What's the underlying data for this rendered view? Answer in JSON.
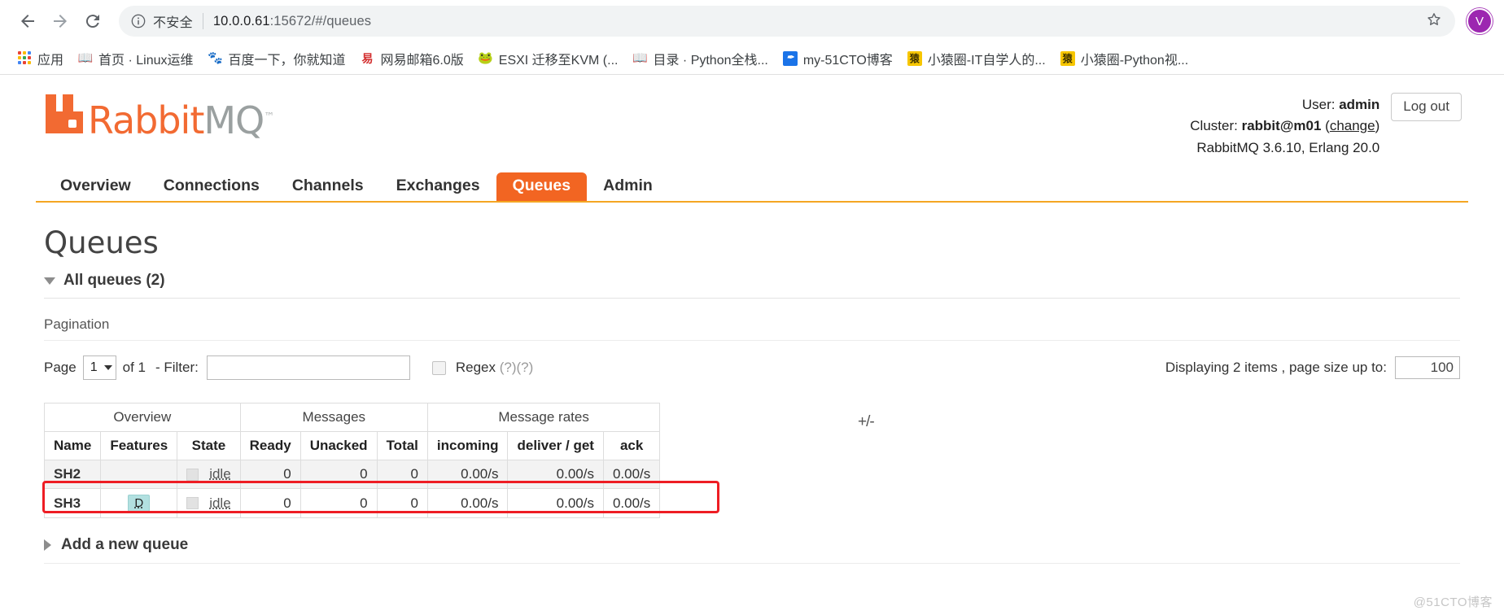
{
  "browser": {
    "back_icon": "back-arrow-icon",
    "forward_icon": "forward-arrow-icon",
    "reload_icon": "reload-icon",
    "security_label": "不安全",
    "url_host": "10.0.0.61",
    "url_rest": ":15672/#/queues",
    "star_icon": "star-icon",
    "profile_initial": "V",
    "bookmarks": [
      {
        "label": "应用",
        "icon": "apps-grid-icon",
        "icon_glyph": "",
        "icon_class": "ico-apps"
      },
      {
        "label": "首页 · Linux运维",
        "icon": "book-icon",
        "icon_glyph": "📖",
        "icon_class": "ico-book"
      },
      {
        "label": "百度一下，你就知道",
        "icon": "baidu-paw-icon",
        "icon_glyph": "🐾",
        "icon_class": "ico-baidu"
      },
      {
        "label": "网易邮箱6.0版",
        "icon": "netease-mail-icon",
        "icon_glyph": "易",
        "icon_class": "ico-163"
      },
      {
        "label": "ESXI 迁移至KVM (...",
        "icon": "esxi-icon",
        "icon_glyph": "🐸",
        "icon_class": "ico-esxi"
      },
      {
        "label": "目录 · Python全栈...",
        "icon": "book-icon",
        "icon_glyph": "📖",
        "icon_class": "ico-book"
      },
      {
        "label": "my-51CTO博客",
        "icon": "feather-icon",
        "icon_glyph": "✒",
        "icon_class": "ico-blue"
      },
      {
        "label": "小猿圈-IT自学人的...",
        "icon": "yuan-icon",
        "icon_glyph": "猿",
        "icon_class": "ico-yuan"
      },
      {
        "label": "小猿圈-Python视...",
        "icon": "yuan-icon",
        "icon_glyph": "猿",
        "icon_class": "ico-yuan"
      }
    ]
  },
  "app": {
    "logo_primary": "Rabbit",
    "logo_secondary": "MQ",
    "logo_tm": "™",
    "user_label": "User:",
    "user_name": "admin",
    "cluster_label": "Cluster:",
    "cluster_name": "rabbit@m01",
    "cluster_change": "change",
    "version_line": "RabbitMQ 3.6.10, Erlang 20.0",
    "logout_label": "Log out",
    "nav": [
      {
        "label": "Overview",
        "active": false
      },
      {
        "label": "Connections",
        "active": false
      },
      {
        "label": "Channels",
        "active": false
      },
      {
        "label": "Exchanges",
        "active": false
      },
      {
        "label": "Queues",
        "active": true
      },
      {
        "label": "Admin",
        "active": false
      }
    ],
    "page_title": "Queues"
  },
  "section": {
    "all_queues_label": "All queues (2)",
    "pagination_label": "Pagination"
  },
  "pagination": {
    "page_label": "Page",
    "page_value": "1",
    "of_label": "of 1",
    "filter_label": "- Filter:",
    "filter_value": "",
    "filter_placeholder": "",
    "regex_label": "Regex",
    "regex_help": "(?)(?)",
    "regex_checked": false,
    "displaying_text": "Displaying 2 items , page size up to:",
    "page_size_value": "100"
  },
  "table": {
    "group_headers": [
      {
        "label": "Overview",
        "colspan": 3
      },
      {
        "label": "Messages",
        "colspan": 3
      },
      {
        "label": "Message rates",
        "colspan": 3
      }
    ],
    "plus_minus": "+/-",
    "columns": [
      "Name",
      "Features",
      "State",
      "Ready",
      "Unacked",
      "Total",
      "incoming",
      "deliver / get",
      "ack"
    ],
    "rows": [
      {
        "name": "SH2",
        "features": "",
        "state_text": "idle",
        "ready": "0",
        "unacked": "0",
        "total": "0",
        "incoming": "0.00/s",
        "deliver_get": "0.00/s",
        "ack": "0.00/s",
        "highlighted": false
      },
      {
        "name": "SH3",
        "features": "D",
        "state_text": "idle",
        "ready": "0",
        "unacked": "0",
        "total": "0",
        "incoming": "0.00/s",
        "deliver_get": "0.00/s",
        "ack": "0.00/s",
        "highlighted": true
      }
    ]
  },
  "footer": {
    "add_queue_label": "Add a new queue",
    "watermark": "@51CTO博客"
  },
  "colors": {
    "brand_orange": "#f26522",
    "nav_underline": "#f5a623",
    "highlight_red": "#ee1d24",
    "feature_badge_bg": "#b2e0e0",
    "avatar": "#9c27b0"
  }
}
